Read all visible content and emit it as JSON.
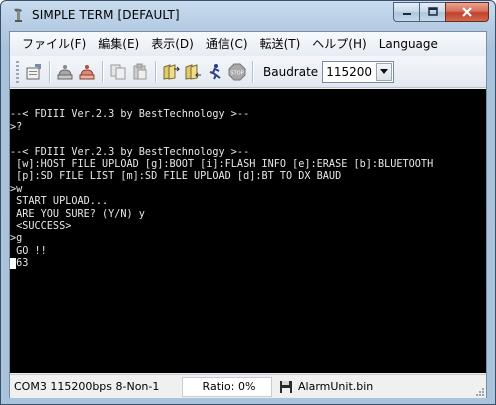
{
  "window": {
    "title": "SIMPLE TERM [DEFAULT]"
  },
  "menu": {
    "items": [
      "ファイル(F)",
      "編集(E)",
      "表示(D)",
      "通信(C)",
      "転送(T)",
      "ヘルプ(H)",
      "Language"
    ]
  },
  "toolbar": {
    "icons": [
      "properties-icon",
      "connect-icon",
      "disconnect-icon",
      "copy-icon",
      "paste-icon",
      "send-files-icon",
      "receive-files-icon",
      "run-icon",
      "stop-icon"
    ],
    "baudrate_label": "Baudrate",
    "baudrate_value": "115200"
  },
  "terminal": {
    "lines": [
      "",
      "--< FDIII Ver.2.3 by BestTechnology >--",
      ">?",
      "",
      "--< FDIII Ver.2.3 by BestTechnology >--",
      " [w]:HOST FILE UPLOAD [g]:BOOT [i]:FLASH INFO [e]:ERASE [b]:BLUETOOTH",
      " [p]:SD FILE LIST [m]:SD FILE UPLOAD [d]:BT TO DX BAUD",
      ">w",
      " START UPLOAD...",
      " ARE YOU SURE? (Y/N) y",
      " <SUCCESS>",
      ">g",
      " GO !!",
      "▌63"
    ]
  },
  "status": {
    "port": "COM3 115200bps 8-Non-1",
    "ratio": "Ratio: 0%",
    "file": "AlarmUnit.bin"
  },
  "colors": {
    "terminal_bg": "#000000",
    "terminal_fg": "#e8e8e8",
    "close_button": "#c7452e"
  }
}
